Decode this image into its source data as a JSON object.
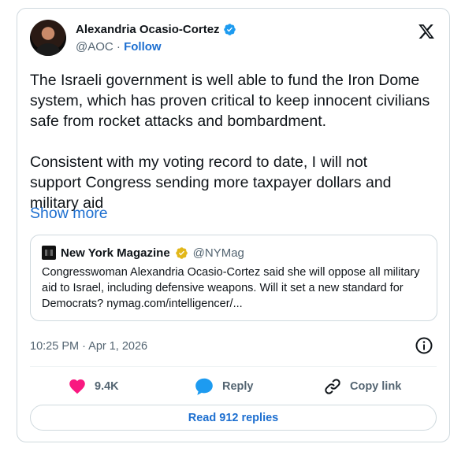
{
  "author": {
    "name": "Alexandria Ocasio-Cortez",
    "handle": "@AOC",
    "separator": "·",
    "follow_label": "Follow",
    "verified_icon": "verified-badge-icon",
    "verified_color": "#1d9bf0"
  },
  "platform_icon": "x-logo-icon",
  "tweet": {
    "paragraph1": "The Israeli government is well able to fund the Iron Dome\nsystem, which has proven critical to keep innocent civilians\nsafe from rocket attacks and bombardment.",
    "paragraph2": "Consistent with my voting record to date, I will not\nsupport Congress sending more taxpayer dollars and\nmilitary aid",
    "show_more_label": "Show more"
  },
  "quote": {
    "name": "New York Magazine",
    "handle": "@NYMag",
    "badge_color": "#e2b719",
    "text": "Congresswoman Alexandria Ocasio-Cortez said she will oppose all military aid to Israel, including defensive weapons. Will it set a new standard for Democrats? nymag.com/intelligencer/..."
  },
  "timestamp": "10:25 PM · Apr 1, 2026",
  "actions": {
    "like_count": "9.4K",
    "reply_label": "Reply",
    "copy_label": "Copy link",
    "like_color": "#f91880",
    "reply_color": "#1d9bf0"
  },
  "read_replies_label": "Read 912 replies",
  "colors": {
    "accent": "#1d6fd0",
    "secondary_text": "#536471",
    "border": "#cfd9de"
  }
}
